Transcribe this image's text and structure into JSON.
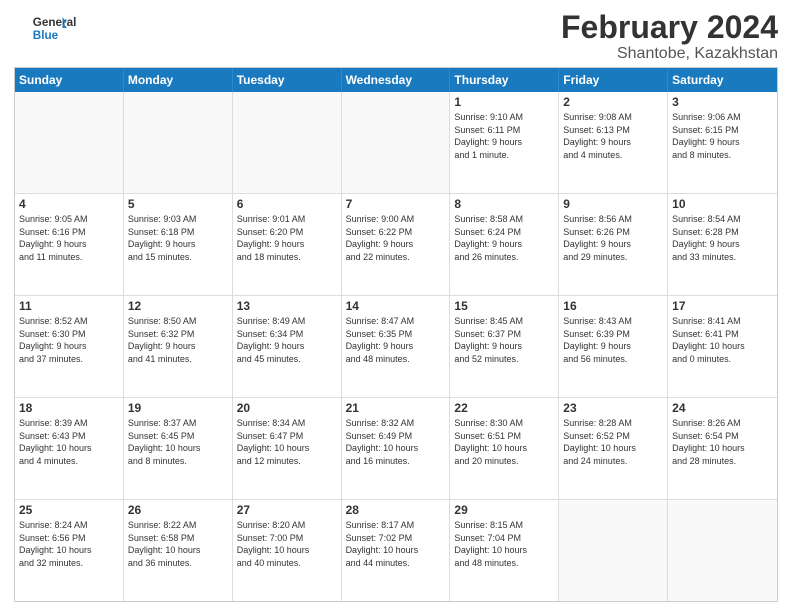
{
  "header": {
    "logo_general": "General",
    "logo_blue": "Blue",
    "month_year": "February 2024",
    "location": "Shantobe, Kazakhstan"
  },
  "days_of_week": [
    "Sunday",
    "Monday",
    "Tuesday",
    "Wednesday",
    "Thursday",
    "Friday",
    "Saturday"
  ],
  "weeks": [
    [
      {
        "day": "",
        "info": "",
        "empty": true
      },
      {
        "day": "",
        "info": "",
        "empty": true
      },
      {
        "day": "",
        "info": "",
        "empty": true
      },
      {
        "day": "",
        "info": "",
        "empty": true
      },
      {
        "day": "1",
        "info": "Sunrise: 9:10 AM\nSunset: 6:11 PM\nDaylight: 9 hours\nand 1 minute."
      },
      {
        "day": "2",
        "info": "Sunrise: 9:08 AM\nSunset: 6:13 PM\nDaylight: 9 hours\nand 4 minutes."
      },
      {
        "day": "3",
        "info": "Sunrise: 9:06 AM\nSunset: 6:15 PM\nDaylight: 9 hours\nand 8 minutes."
      }
    ],
    [
      {
        "day": "4",
        "info": "Sunrise: 9:05 AM\nSunset: 6:16 PM\nDaylight: 9 hours\nand 11 minutes."
      },
      {
        "day": "5",
        "info": "Sunrise: 9:03 AM\nSunset: 6:18 PM\nDaylight: 9 hours\nand 15 minutes."
      },
      {
        "day": "6",
        "info": "Sunrise: 9:01 AM\nSunset: 6:20 PM\nDaylight: 9 hours\nand 18 minutes."
      },
      {
        "day": "7",
        "info": "Sunrise: 9:00 AM\nSunset: 6:22 PM\nDaylight: 9 hours\nand 22 minutes."
      },
      {
        "day": "8",
        "info": "Sunrise: 8:58 AM\nSunset: 6:24 PM\nDaylight: 9 hours\nand 26 minutes."
      },
      {
        "day": "9",
        "info": "Sunrise: 8:56 AM\nSunset: 6:26 PM\nDaylight: 9 hours\nand 29 minutes."
      },
      {
        "day": "10",
        "info": "Sunrise: 8:54 AM\nSunset: 6:28 PM\nDaylight: 9 hours\nand 33 minutes."
      }
    ],
    [
      {
        "day": "11",
        "info": "Sunrise: 8:52 AM\nSunset: 6:30 PM\nDaylight: 9 hours\nand 37 minutes."
      },
      {
        "day": "12",
        "info": "Sunrise: 8:50 AM\nSunset: 6:32 PM\nDaylight: 9 hours\nand 41 minutes."
      },
      {
        "day": "13",
        "info": "Sunrise: 8:49 AM\nSunset: 6:34 PM\nDaylight: 9 hours\nand 45 minutes."
      },
      {
        "day": "14",
        "info": "Sunrise: 8:47 AM\nSunset: 6:35 PM\nDaylight: 9 hours\nand 48 minutes."
      },
      {
        "day": "15",
        "info": "Sunrise: 8:45 AM\nSunset: 6:37 PM\nDaylight: 9 hours\nand 52 minutes."
      },
      {
        "day": "16",
        "info": "Sunrise: 8:43 AM\nSunset: 6:39 PM\nDaylight: 9 hours\nand 56 minutes."
      },
      {
        "day": "17",
        "info": "Sunrise: 8:41 AM\nSunset: 6:41 PM\nDaylight: 10 hours\nand 0 minutes."
      }
    ],
    [
      {
        "day": "18",
        "info": "Sunrise: 8:39 AM\nSunset: 6:43 PM\nDaylight: 10 hours\nand 4 minutes."
      },
      {
        "day": "19",
        "info": "Sunrise: 8:37 AM\nSunset: 6:45 PM\nDaylight: 10 hours\nand 8 minutes."
      },
      {
        "day": "20",
        "info": "Sunrise: 8:34 AM\nSunset: 6:47 PM\nDaylight: 10 hours\nand 12 minutes."
      },
      {
        "day": "21",
        "info": "Sunrise: 8:32 AM\nSunset: 6:49 PM\nDaylight: 10 hours\nand 16 minutes."
      },
      {
        "day": "22",
        "info": "Sunrise: 8:30 AM\nSunset: 6:51 PM\nDaylight: 10 hours\nand 20 minutes."
      },
      {
        "day": "23",
        "info": "Sunrise: 8:28 AM\nSunset: 6:52 PM\nDaylight: 10 hours\nand 24 minutes."
      },
      {
        "day": "24",
        "info": "Sunrise: 8:26 AM\nSunset: 6:54 PM\nDaylight: 10 hours\nand 28 minutes."
      }
    ],
    [
      {
        "day": "25",
        "info": "Sunrise: 8:24 AM\nSunset: 6:56 PM\nDaylight: 10 hours\nand 32 minutes."
      },
      {
        "day": "26",
        "info": "Sunrise: 8:22 AM\nSunset: 6:58 PM\nDaylight: 10 hours\nand 36 minutes."
      },
      {
        "day": "27",
        "info": "Sunrise: 8:20 AM\nSunset: 7:00 PM\nDaylight: 10 hours\nand 40 minutes."
      },
      {
        "day": "28",
        "info": "Sunrise: 8:17 AM\nSunset: 7:02 PM\nDaylight: 10 hours\nand 44 minutes."
      },
      {
        "day": "29",
        "info": "Sunrise: 8:15 AM\nSunset: 7:04 PM\nDaylight: 10 hours\nand 48 minutes."
      },
      {
        "day": "",
        "info": "",
        "empty": true
      },
      {
        "day": "",
        "info": "",
        "empty": true
      }
    ]
  ]
}
